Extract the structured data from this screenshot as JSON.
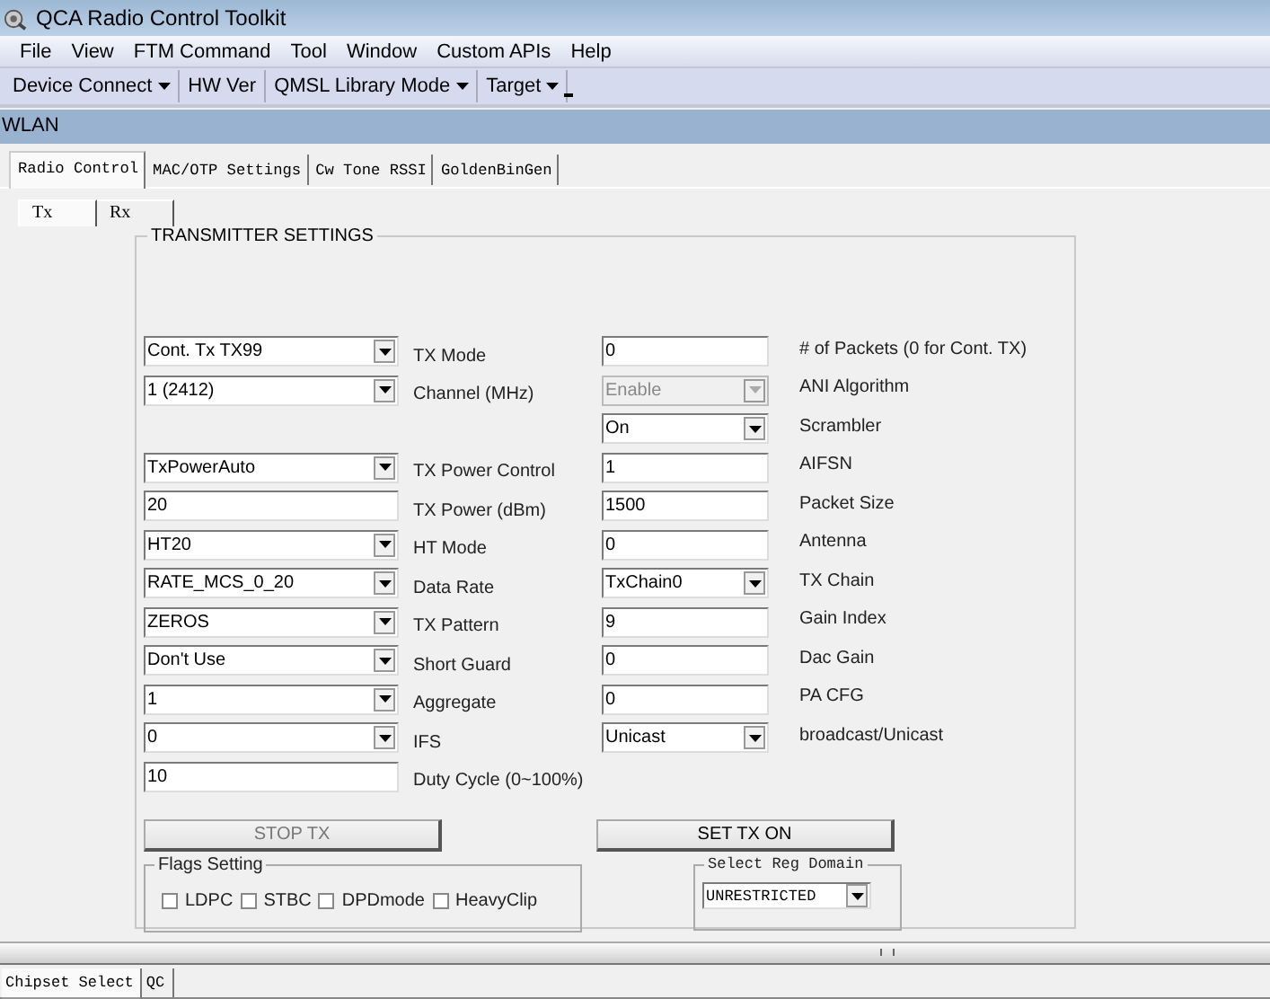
{
  "window": {
    "title": "QCA Radio Control Toolkit"
  },
  "menu": [
    "File",
    "View",
    "FTM Command",
    "Tool",
    "Window",
    "Custom APIs",
    "Help"
  ],
  "toolbar": [
    {
      "label": "Device Connect",
      "dropdown": true
    },
    {
      "label": "HW Ver",
      "dropdown": false
    },
    {
      "label": "QMSL Library Mode",
      "dropdown": true
    },
    {
      "label": "Target",
      "dropdown": true
    }
  ],
  "panel": {
    "title": "WLAN"
  },
  "tabs": [
    {
      "label": "Radio Control",
      "selected": true
    },
    {
      "label": "MAC/OTP Settings",
      "selected": false
    },
    {
      "label": "Cw Tone RSSI",
      "selected": false
    },
    {
      "label": "GoldenBinGen",
      "selected": false
    }
  ],
  "subtabs": [
    {
      "label": "Tx",
      "selected": true
    },
    {
      "label": "Rx",
      "selected": false
    }
  ],
  "group": {
    "title": "TRANSMITTER SETTINGS"
  },
  "left_fields": [
    {
      "kind": "dropdown",
      "value": "Cont. Tx TX99",
      "label": "TX Mode",
      "disabled": false
    },
    {
      "kind": "dropdown",
      "value": "1 (2412)",
      "label": "Channel (MHz)",
      "disabled": false
    },
    {
      "kind": "dropdown",
      "value": "TxPowerAuto",
      "label": "TX Power Control",
      "disabled": false
    },
    {
      "kind": "text",
      "value": "20",
      "label": "TX Power (dBm)",
      "disabled": false
    },
    {
      "kind": "dropdown",
      "value": "HT20",
      "label": "HT Mode",
      "disabled": false
    },
    {
      "kind": "dropdown",
      "value": "RATE_MCS_0_20",
      "label": "Data Rate",
      "disabled": false
    },
    {
      "kind": "dropdown",
      "value": "ZEROS",
      "label": "TX Pattern",
      "disabled": false
    },
    {
      "kind": "dropdown",
      "value": "Don't Use",
      "label": "Short Guard",
      "disabled": false
    },
    {
      "kind": "dropdown",
      "value": "1",
      "label": "Aggregate",
      "disabled": false
    },
    {
      "kind": "dropdown",
      "value": "0",
      "label": "IFS",
      "disabled": false
    },
    {
      "kind": "text",
      "value": "10",
      "label": "Duty Cycle (0~100%)",
      "disabled": false
    }
  ],
  "right_fields": [
    {
      "kind": "text",
      "value": "0",
      "label": "# of Packets (0 for Cont. TX)",
      "disabled": false
    },
    {
      "kind": "dropdown",
      "value": "Enable",
      "label": "ANI Algorithm",
      "disabled": true
    },
    {
      "kind": "dropdown",
      "value": "On",
      "label": "Scrambler",
      "disabled": false
    },
    {
      "kind": "text",
      "value": "1",
      "label": "AIFSN",
      "disabled": false
    },
    {
      "kind": "text",
      "value": "1500",
      "label": "Packet Size",
      "disabled": false
    },
    {
      "kind": "text",
      "value": "0",
      "label": "Antenna",
      "disabled": false
    },
    {
      "kind": "dropdown",
      "value": "TxChain0",
      "label": "TX Chain",
      "disabled": false
    },
    {
      "kind": "text",
      "value": "9",
      "label": "Gain Index",
      "disabled": false
    },
    {
      "kind": "text",
      "value": "0",
      "label": "Dac Gain",
      "disabled": false
    },
    {
      "kind": "text",
      "value": "0",
      "label": "PA CFG",
      "disabled": false
    },
    {
      "kind": "dropdown",
      "value": "Unicast",
      "label": "broadcast/Unicast",
      "disabled": false
    }
  ],
  "buttons": [
    {
      "label": "STOP TX",
      "disabled": true
    },
    {
      "label": "SET TX ON",
      "disabled": false
    }
  ],
  "flags": {
    "title": "Flags Setting",
    "items": [
      {
        "label": "LDPC",
        "checked": false
      },
      {
        "label": "STBC",
        "checked": false
      },
      {
        "label": "DPDmode",
        "checked": false
      },
      {
        "label": "HeavyClip",
        "checked": false
      }
    ]
  },
  "reg_domain": {
    "title": "Select Reg Domain",
    "value": "UNRESTRICTED"
  },
  "bottom_tabs": [
    {
      "label": "Chipset Select",
      "selected": true
    },
    {
      "label": "QC",
      "selected": false
    }
  ]
}
